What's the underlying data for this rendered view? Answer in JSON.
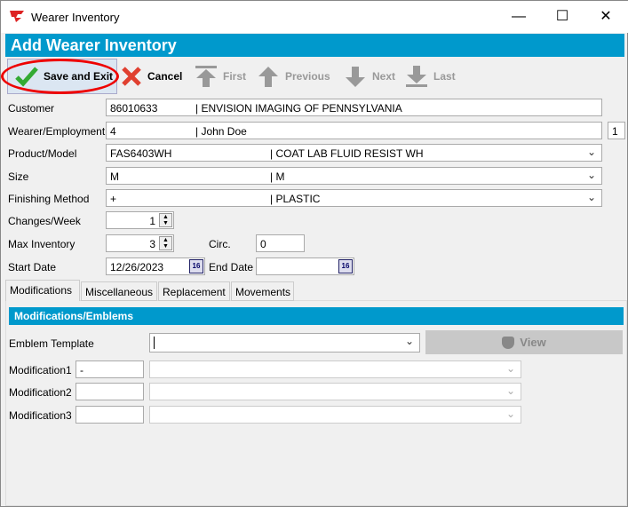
{
  "window": {
    "title": "Wearer Inventory",
    "minimize": "—",
    "maximize": "☐",
    "close": "✕"
  },
  "header": {
    "title": "Add Wearer Inventory"
  },
  "toolbar": {
    "save": "Save and Exit",
    "cancel": "Cancel",
    "first": "First",
    "previous": "Previous",
    "next": "Next",
    "last": "Last"
  },
  "form": {
    "customer": {
      "label": "Customer",
      "code": "86010633",
      "name": "| ENVISION IMAGING OF PENNSYLVANIA"
    },
    "wearer": {
      "label": "Wearer/Employment",
      "code": "4",
      "name": "| John Doe",
      "extra": "1"
    },
    "product": {
      "label": "Product/Model",
      "code": "FAS6403WH",
      "name": "| COAT LAB FLUID RESIST WH"
    },
    "size": {
      "label": "Size",
      "code": "M",
      "name": "| M"
    },
    "finishing": {
      "label": "Finishing Method",
      "code": "+",
      "name": "| PLASTIC"
    },
    "changes": {
      "label": "Changes/Week",
      "value": "1"
    },
    "max_inventory": {
      "label": "Max Inventory",
      "value": "3"
    },
    "circ": {
      "label": "Circ.",
      "value": "0"
    },
    "start_date": {
      "label": "Start Date",
      "value": "12/26/2023"
    },
    "end_date": {
      "label": "End Date",
      "value": ""
    },
    "calendar_icon_text": "16"
  },
  "tabs": [
    {
      "label": "Modifications"
    },
    {
      "label": "Miscellaneous"
    },
    {
      "label": "Replacement"
    },
    {
      "label": "Movements"
    }
  ],
  "modifications": {
    "section_title": "Modifications/Emblems",
    "emblem_label": "Emblem Template",
    "emblem_value": "",
    "view": "View",
    "rows": [
      {
        "label": "Modification1",
        "code": "-",
        "value": ""
      },
      {
        "label": "Modification2",
        "code": "",
        "value": ""
      },
      {
        "label": "Modification3",
        "code": "",
        "value": ""
      }
    ]
  }
}
